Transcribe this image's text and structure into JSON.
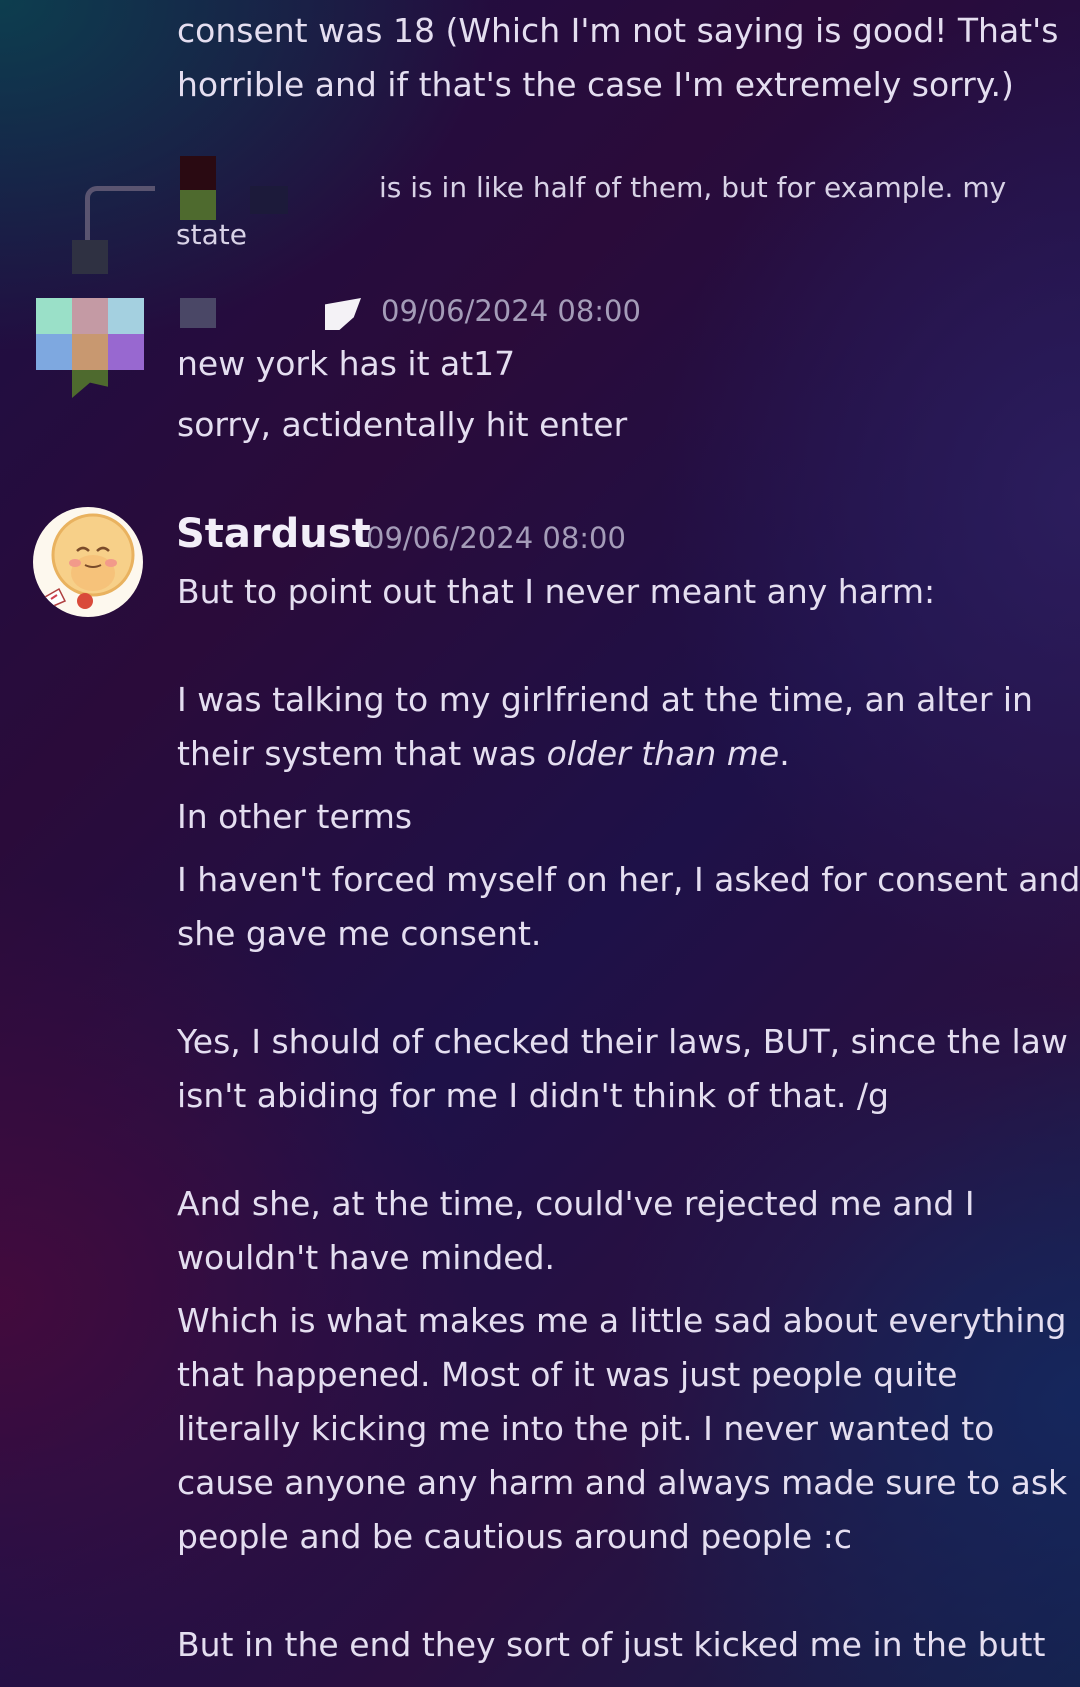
{
  "messages_top": {
    "lines": [
      "consent was 18 (Which I'm not saying is good! That's",
      "horrible and if that's the case I'm extremely sorry.)"
    ]
  },
  "reply_preview": {
    "text_line1": "is is in like half of them, but for example. my",
    "text_line2": "state"
  },
  "redacted_message": {
    "timestamp": "09/06/2024 08:00",
    "lines": [
      "new york has it at17",
      "sorry, actidentally hit enter"
    ]
  },
  "stardust_message": {
    "username": "Stardust",
    "timestamp": "09/06/2024 08:00",
    "line_1": "But to point out that I never meant any harm:",
    "line_2": "I was talking to my girlfriend at the time, an alter in",
    "line_3_prefix": "their system that was ",
    "line_3_italic": "older than me",
    "line_3_suffix": ".",
    "line_4": "In other terms",
    "line_5": "I haven't forced myself on her, I asked for consent and",
    "line_6": "she gave me consent.",
    "line_7": "Yes, I should of checked their laws, BUT, since the law",
    "line_8": "isn't abiding for me I didn't think of that. /g",
    "line_9": "And she, at the time, could've rejected me and I",
    "line_10": "wouldn't have minded.",
    "line_11": "Which is what makes me a little sad about everything",
    "line_12": "that happened. Most of it was just people quite",
    "line_13": "literally kicking me into the pit. I never wanted to",
    "line_14": "cause anyone any harm and always made sure to ask",
    "line_15": "people and be cautious around people :c",
    "line_16": "But in the end they sort of just kicked me in the butt"
  },
  "colors": {
    "text": "#e4def0",
    "meta": "#a49cb8",
    "username": "#f2eef8"
  }
}
